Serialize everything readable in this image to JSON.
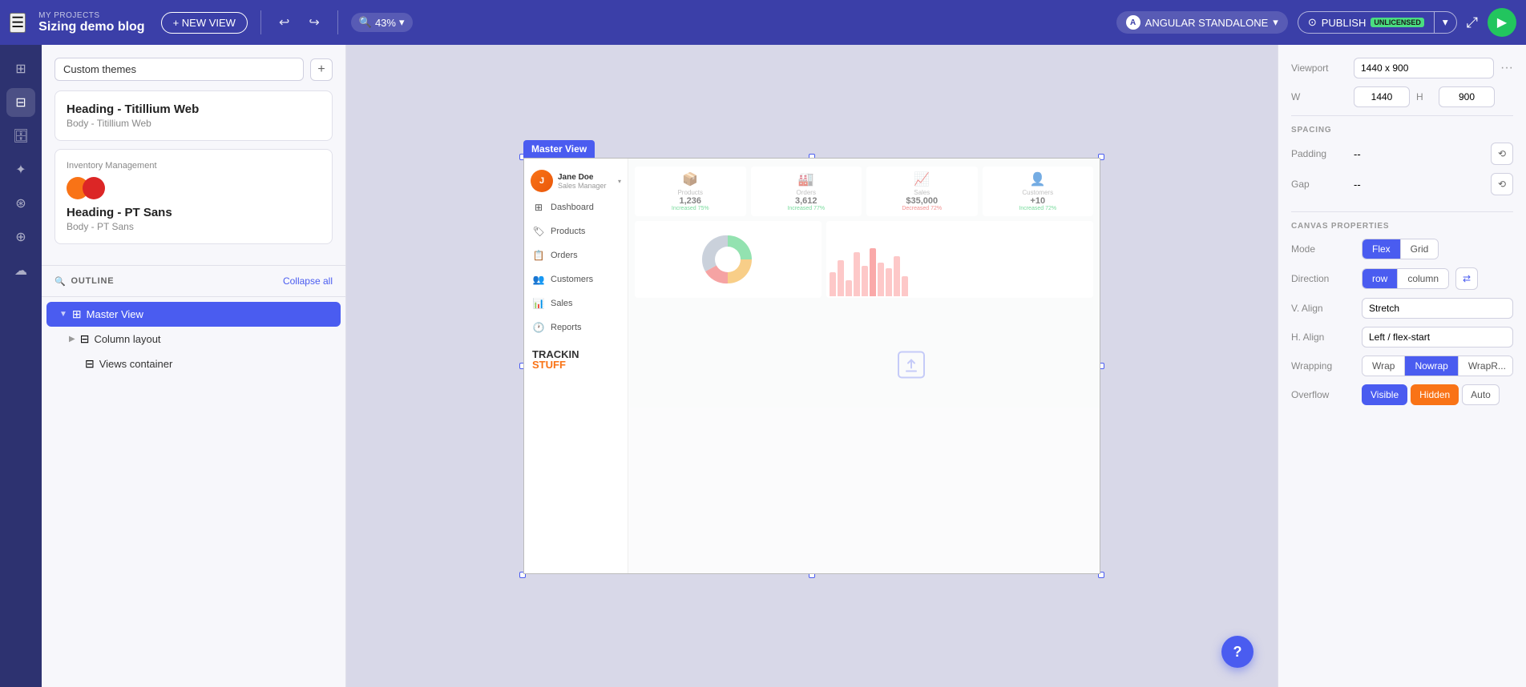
{
  "topbar": {
    "my_projects_label": "MY PROJECTS",
    "project_name": "Sizing demo blog",
    "new_view_btn": "+ NEW VIEW",
    "zoom_level": "43%",
    "framework_label": "ANGULAR STANDALONE",
    "framework_icon": "A",
    "publish_label": "PUBLISH",
    "publish_badge": "UNLICENSED",
    "share_label": "share",
    "play_label": "play"
  },
  "left_panel": {
    "themes_section": {
      "select_value": "Custom themes",
      "add_btn_label": "+",
      "card1": {
        "title": "Heading - Titillium Web",
        "subtitle": "Body - Titillium Web"
      },
      "card2": {
        "label": "Inventory Management",
        "circle1_color": "#f97316",
        "circle2_color": "#dc2626",
        "title": "Heading - PT Sans",
        "subtitle": "Body - PT Sans"
      }
    },
    "outline": {
      "title": "OUTLINE",
      "collapse_all": "Collapse all",
      "items": [
        {
          "label": "Master View",
          "icon": "⊞",
          "selected": true,
          "expanded": true,
          "depth": 0
        },
        {
          "label": "Column layout",
          "icon": "⊟",
          "selected": false,
          "expanded": false,
          "depth": 1
        },
        {
          "label": "Views container",
          "icon": "⊟",
          "selected": false,
          "expanded": false,
          "depth": 2
        }
      ]
    }
  },
  "canvas": {
    "master_view_label": "Master View"
  },
  "dashboard_preview": {
    "user_name": "Jane Doe",
    "user_role": "Sales Manager",
    "nav_items": [
      "Dashboard",
      "Products",
      "Orders",
      "Customers",
      "Sales",
      "Reports"
    ],
    "logo_line1": "TRACKIN",
    "logo_line2": "STUFF",
    "stats": [
      {
        "label": "Products",
        "value": "1,236",
        "change": "Increased 75%"
      },
      {
        "label": "Orders",
        "value": "3,612",
        "change": "Increased 77%"
      },
      {
        "label": "Sales",
        "value": "$35,000",
        "change": "Decreased 72%"
      },
      {
        "label": "Customers",
        "value": "+10",
        "change": "Increased 72%"
      }
    ]
  },
  "right_panel": {
    "viewport_label": "Viewport",
    "viewport_value": "1440 x 900",
    "w_label": "W",
    "w_value": "1440",
    "h_label": "H",
    "h_value": "900",
    "spacing_title": "SPACING",
    "padding_label": "Padding",
    "padding_value": "--",
    "gap_label": "Gap",
    "gap_value": "--",
    "canvas_props_title": "CANVAS PROPERTIES",
    "mode_label": "Mode",
    "flex_label": "Flex",
    "grid_label": "Grid",
    "direction_label": "Direction",
    "row_label": "row",
    "column_label": "column",
    "valign_label": "V. Align",
    "valign_value": "Stretch",
    "halign_label": "H. Align",
    "halign_value": "Left / flex-start",
    "wrapping_label": "Wrapping",
    "wrap_label": "Wrap",
    "nowrap_label": "Nowrap",
    "wrapr_label": "WrapR...",
    "overflow_label": "Overflow",
    "visible_label": "Visible",
    "hidden_label": "Hidden",
    "auto_label": "Auto"
  },
  "help_btn": "?"
}
